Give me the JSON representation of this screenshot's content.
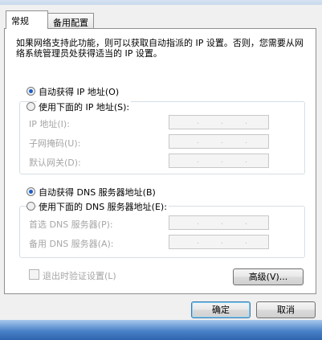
{
  "tabs": [
    "常规",
    "备用配置"
  ],
  "description": "如果网络支持此功能，则可以获取自动指派的 IP 设置。否则，您需要从网络系统管理员处获得适当的 IP 设置。",
  "ip_section": {
    "auto_label": "自动获得 IP 地址(O)",
    "manual_label": "使用下面的 IP 地址(S):",
    "selected": "auto",
    "fields": [
      {
        "label": "IP 地址(I):",
        "value": ". . ."
      },
      {
        "label": "子网掩码(U):",
        "value": ". . ."
      },
      {
        "label": "默认网关(D):",
        "value": ". . ."
      }
    ]
  },
  "dns_section": {
    "auto_label": "自动获得 DNS 服务器地址(B)",
    "manual_label": "使用下面的 DNS 服务器地址(E):",
    "selected": "auto",
    "fields": [
      {
        "label": "首选 DNS 服务器(P):",
        "value": ". . ."
      },
      {
        "label": "备用 DNS 服务器(A):",
        "value": ". . ."
      }
    ]
  },
  "validate_label": "退出时验证设置(L)",
  "advanced_label": "高级(V)...",
  "ok_label": "确定",
  "cancel_label": "取消"
}
